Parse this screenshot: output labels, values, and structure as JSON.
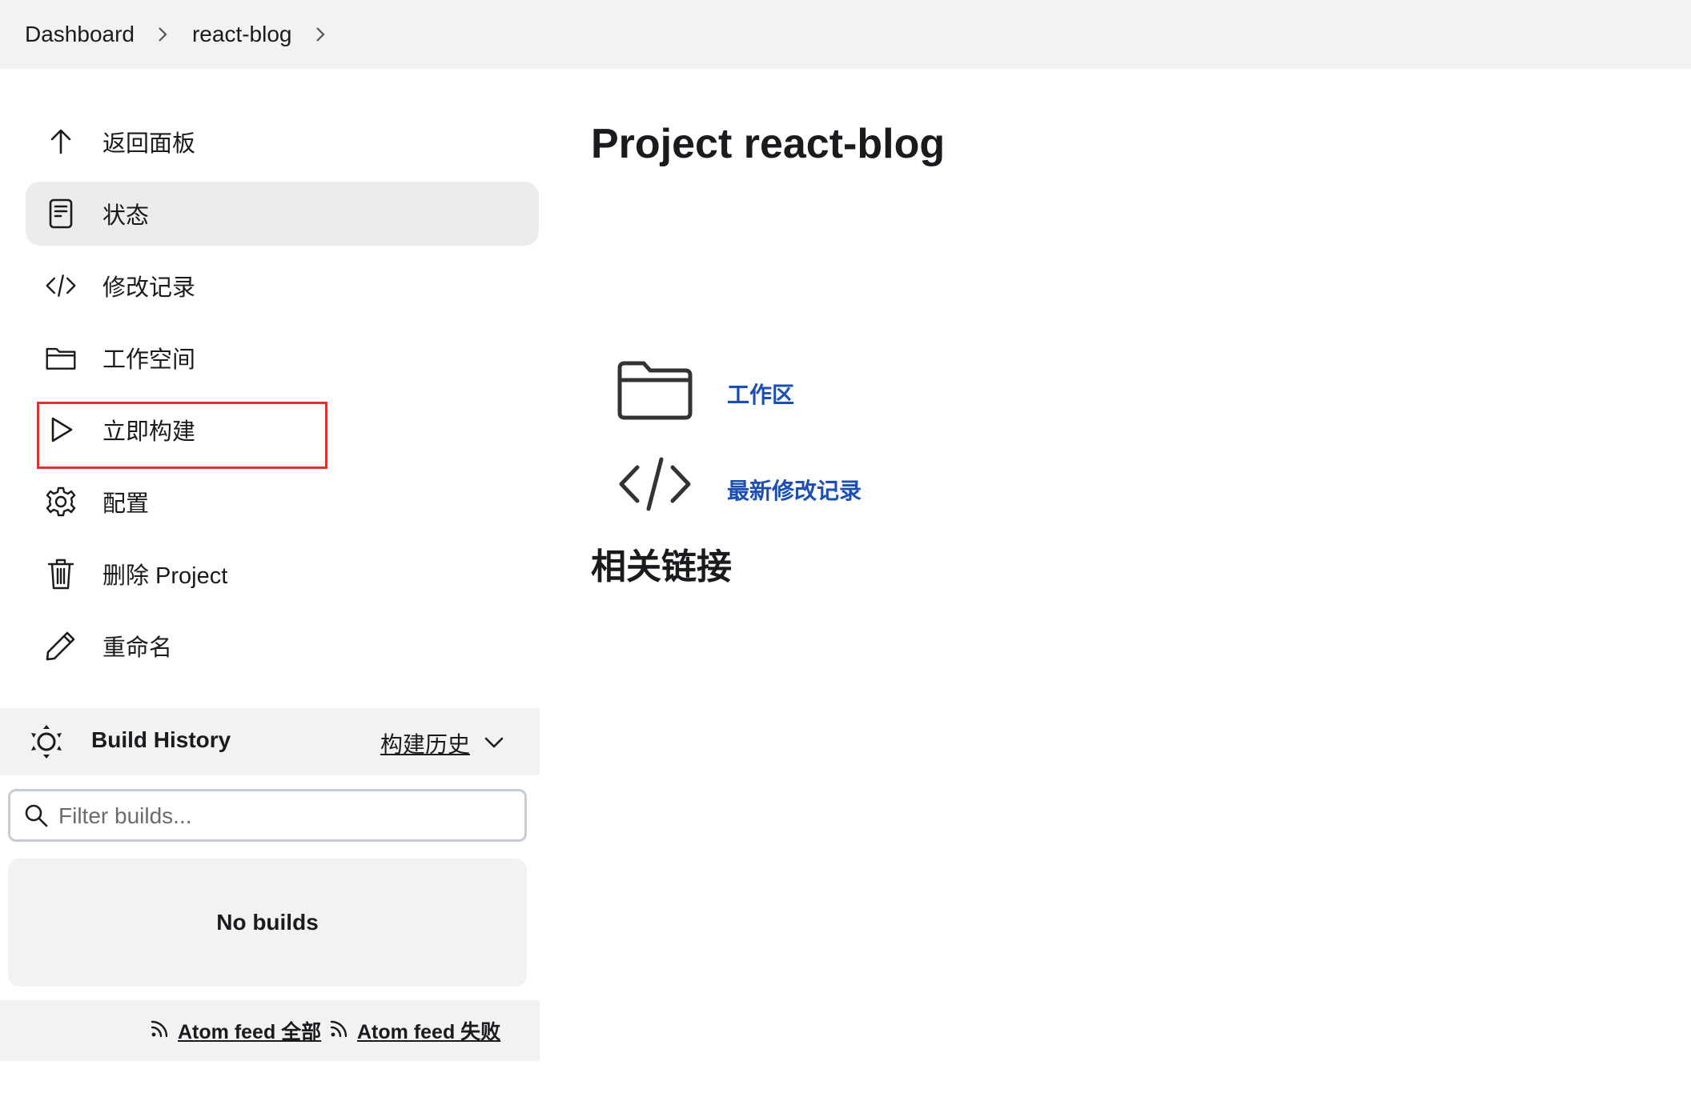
{
  "breadcrumb": {
    "items": [
      "Dashboard",
      "react-blog"
    ]
  },
  "sidebar": {
    "items": [
      {
        "label": "返回面板",
        "icon": "arrow-up-icon"
      },
      {
        "label": "状态",
        "icon": "document-icon",
        "active": true
      },
      {
        "label": "修改记录",
        "icon": "code-icon"
      },
      {
        "label": "工作空间",
        "icon": "folder-icon"
      },
      {
        "label": "立即构建",
        "icon": "play-icon",
        "highlighted": true
      },
      {
        "label": "配置",
        "icon": "gear-icon"
      },
      {
        "label": "删除 Project",
        "icon": "trash-icon"
      },
      {
        "label": "重命名",
        "icon": "pencil-icon"
      }
    ]
  },
  "build_history": {
    "title": "Build History",
    "link": "构建历史",
    "filter_placeholder": "Filter builds...",
    "empty_text": "No builds",
    "feeds": [
      "Atom feed 全部",
      "Atom feed 失败"
    ]
  },
  "main": {
    "title": "Project react-blog",
    "links": [
      {
        "label": "工作区",
        "icon": "folder-icon"
      },
      {
        "label": "最新修改记录",
        "icon": "code-icon"
      }
    ],
    "section_title": "相关链接"
  },
  "colors": {
    "link": "#1d4fb3",
    "highlight_border": "#e0322e",
    "active_bg": "#ececec",
    "bar_bg": "#f2f2f2"
  }
}
